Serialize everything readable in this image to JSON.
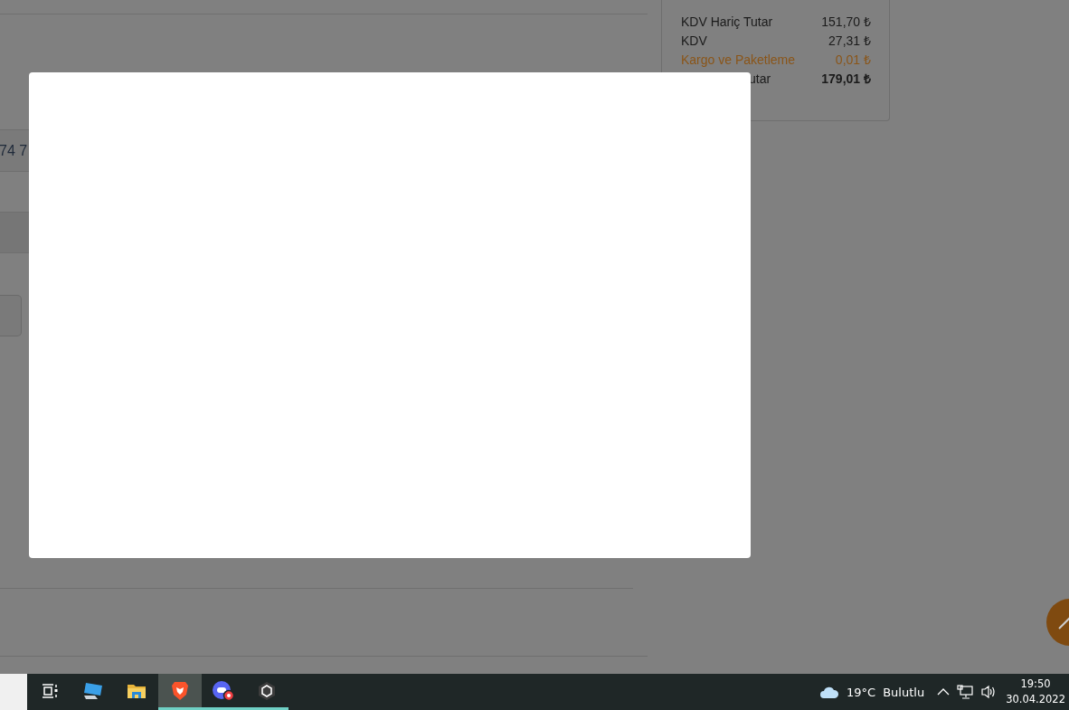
{
  "summary": {
    "rows": [
      {
        "label": "KDV Hariç Tutar",
        "value": "151,70",
        "currency": "₺",
        "kind": "normal"
      },
      {
        "label": "KDV",
        "value": "27,31",
        "currency": "₺",
        "kind": "normal"
      },
      {
        "label": "Kargo ve Paketleme",
        "value": "0,01",
        "currency": "₺",
        "kind": "shipping"
      },
      {
        "label": "utar",
        "value": "179,01",
        "currency": "₺",
        "kind": "total"
      }
    ]
  },
  "phone_fragment": "74 7",
  "taskbar": {
    "apps": [
      {
        "kind": "taskview",
        "selected": false,
        "running": false
      },
      {
        "kind": "pc",
        "selected": false,
        "running": false
      },
      {
        "kind": "folder",
        "selected": false,
        "running": false
      },
      {
        "kind": "brave",
        "selected": true,
        "running": true
      },
      {
        "kind": "discord",
        "selected": false,
        "running": true
      },
      {
        "kind": "unity",
        "selected": false,
        "running": true
      }
    ],
    "weather": {
      "temperature": "19°C",
      "condition": "Bulutlu"
    },
    "time": "19:50",
    "date": "30.04.2022"
  }
}
